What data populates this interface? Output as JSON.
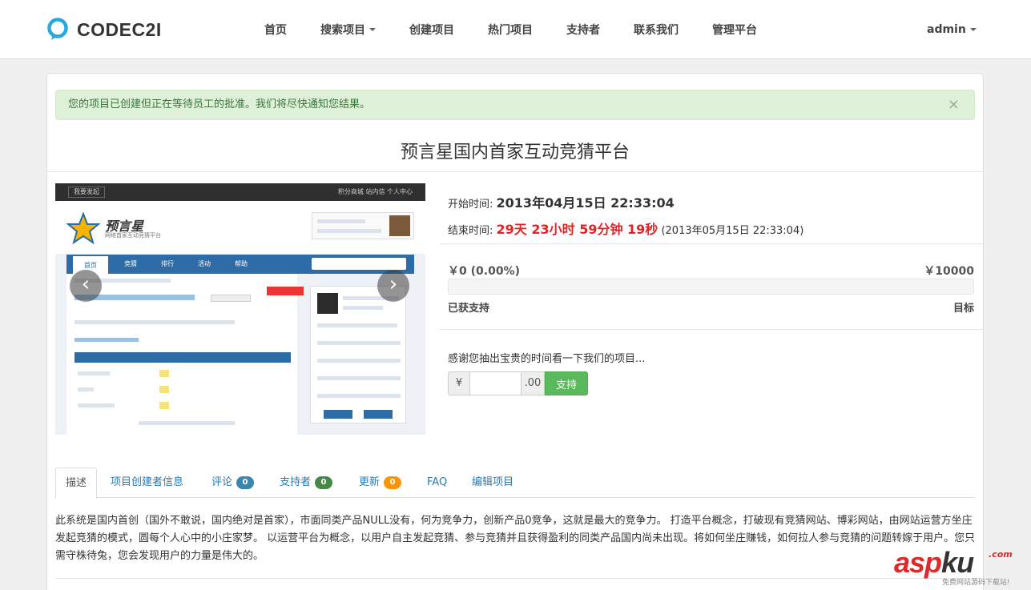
{
  "app": {
    "name": "CODEC2I"
  },
  "nav": {
    "items": [
      "首页",
      "搜索项目",
      "创建项目",
      "热门项目",
      "支持者",
      "联系我们",
      "管理平台"
    ],
    "user": "admin"
  },
  "alert": {
    "message": "您的项目已创建但正在等待员工的批准。我们将尽快通知您结果。",
    "close": "×"
  },
  "project": {
    "title": "预言星国内首家互动竞猜平台",
    "start_label": "开始时间:",
    "start_value": "2013年04月15日 22:33:04",
    "end_label": "结束时间:",
    "end_countdown": "29天 23小时 59分钟 19秒",
    "end_value": "(2013年05月15日 22:33:04)"
  },
  "funding": {
    "raised": "￥0 (0.00%)",
    "goal": "￥10000",
    "progress_pct": 0,
    "raised_label": "已获支持",
    "goal_label": "目标"
  },
  "support": {
    "prompt": "感谢您抽出宝贵的时间看一下我们的项目...",
    "currency": "¥",
    "decimal": ".00",
    "input_value": "",
    "button": "支持"
  },
  "carousel": {
    "prev": "‹",
    "next": "›",
    "shot": {
      "top_button": "我要发起",
      "top_right": "积分商城  站内信  个人中心",
      "brand": "预言星",
      "brand_sub": "网络首家互动竞猜平台",
      "tabs": [
        "首页",
        "竞猜",
        "排行",
        "活动",
        "帮助"
      ]
    }
  },
  "tabs": [
    {
      "label": "描述"
    },
    {
      "label": "项目创建者信息"
    },
    {
      "label": "评论",
      "count": "0",
      "color": "#3a87ad"
    },
    {
      "label": "支持者",
      "count": "0",
      "color": "#468847"
    },
    {
      "label": "更新",
      "count": "0",
      "color": "#f89406"
    },
    {
      "label": "FAQ"
    },
    {
      "label": "编辑项目"
    }
  ],
  "description": "此系统是国内首创（国外不敢说，国内绝对是首家），市面同类产品NULL没有，何为竞争力，创新产品0竞争，这就是最大的竞争力。 打造平台概念，打破现有竞猜网站、博彩网站，由网站运营方坐庄发起竞猜的模式，圆每个人心中的小庄家梦。 以运营平台为概念，以用户自主发起竞猜、参与竞猜并且获得盈利的同类产品国内尚未出现。将如何坐庄赚钱，如何拉人参与竞猜的问题转嫁于用户。您只需守株待兔，您会发现用户的力量是伟大的。",
  "watermark": {
    "main_a": "asp",
    "main_k": "ku",
    "com": ".com",
    "sub": "免费网站源码下载站!"
  },
  "colors": {
    "accent": "#2a7ab0",
    "success": "#5cb85c",
    "danger": "#e02424",
    "alert_bg": "#dff0d8"
  }
}
